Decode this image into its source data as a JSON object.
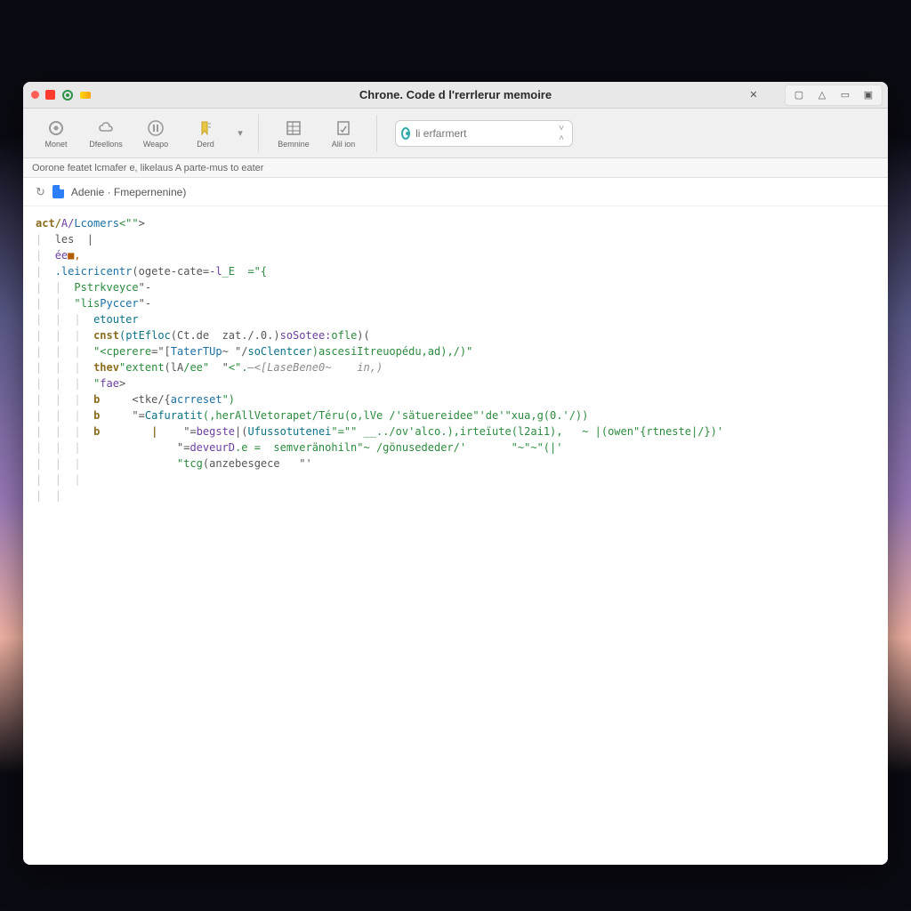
{
  "window": {
    "title": "Chrone. Code d l'rerrlerur memoire"
  },
  "titlebar_icons": {
    "close": "close",
    "stop": "stop",
    "record": "record",
    "status": "status"
  },
  "win_right": [
    "✕",
    "▢",
    "△",
    "▭",
    "▣"
  ],
  "toolbar": {
    "group1": [
      {
        "label": "Monet",
        "icon": "target"
      },
      {
        "label": "Dfeellons",
        "icon": "cloud"
      },
      {
        "label": "Weapo",
        "icon": "pause"
      },
      {
        "label": "Derd",
        "icon": "bookmark"
      }
    ],
    "dropdown": "▾",
    "group2": [
      {
        "label": "Bemnine",
        "icon": "grid"
      },
      {
        "label": "Alil ion",
        "icon": "doc"
      }
    ]
  },
  "search": {
    "placeholder": "li erfarmert"
  },
  "status_strip": "Oorone featet lcmafer e, likelaus A parte-mus to eater",
  "breadcrumb": {
    "reload": "↻",
    "file_label": "Adenie · Fmepernenine)"
  },
  "code_lines": [
    {
      "indent": 0,
      "tokens": [
        {
          "t": "act/",
          "c": "kw"
        },
        {
          "t": "A/",
          "c": "attr"
        },
        {
          "t": "Lcomers",
          "c": "class"
        },
        {
          "t": "<\"\"",
          "c": "str"
        },
        {
          "t": ">",
          "c": "punc"
        }
      ]
    },
    {
      "indent": 1,
      "tokens": [
        {
          "t": "les  |",
          "c": "punc"
        }
      ]
    },
    {
      "indent": 1,
      "tokens": [
        {
          "t": "ée",
          "c": "attr"
        },
        {
          "t": "■,",
          "c": "num"
        }
      ]
    },
    {
      "indent": 1,
      "tokens": [
        {
          "t": ".leicricentr",
          "c": "class"
        },
        {
          "t": "(ogete-cate=",
          "c": "punc"
        },
        {
          "t": "-l",
          "c": "attr"
        },
        {
          "t": "_E  =\"{",
          "c": "str"
        }
      ]
    },
    {
      "indent": 2,
      "tokens": [
        {
          "t": "Pstrkveyce",
          "c": "str"
        },
        {
          "t": "\"-",
          "c": "punc"
        }
      ]
    },
    {
      "indent": 2,
      "tokens": [
        {
          "t": "\"lis",
          "c": "str"
        },
        {
          "t": "Pyccer",
          "c": "class"
        },
        {
          "t": "\"-",
          "c": "punc"
        }
      ]
    },
    {
      "indent": 3,
      "tokens": [
        {
          "t": "etouter",
          "c": "func"
        }
      ]
    },
    {
      "indent": 3,
      "tokens": [
        {
          "t": "cnst",
          "c": "kw"
        },
        {
          "t": "(ptEfloc",
          "c": "func"
        },
        {
          "t": "(Ct.de  zat./.0.)",
          "c": "punc"
        },
        {
          "t": "soSotee:",
          "c": "attr"
        },
        {
          "t": "ofle",
          "c": "str"
        },
        {
          "t": ")(",
          "c": "punc"
        }
      ]
    },
    {
      "indent": 3,
      "tokens": [
        {
          "t": "\"<cperere",
          "c": "str"
        },
        {
          "t": "=\"[",
          "c": "punc"
        },
        {
          "t": "TaterTUp",
          "c": "class"
        },
        {
          "t": "~ \"/",
          "c": "punc"
        },
        {
          "t": "soClentcer",
          "c": "func"
        },
        {
          "t": ")ascesiItreuopédu,ad),/)\"",
          "c": "str"
        }
      ]
    },
    {
      "indent": 3,
      "tokens": [
        {
          "t": "thev",
          "c": "kw"
        },
        {
          "t": "\"extent",
          "c": "str"
        },
        {
          "t": "(lA",
          "c": "punc"
        },
        {
          "t": "/ee\"",
          "c": "str"
        },
        {
          "t": "  \"",
          "c": "punc"
        },
        {
          "t": "<\".",
          "c": "str"
        },
        {
          "t": "—<[LaseBene0~    in,)",
          "c": "comment"
        }
      ]
    },
    {
      "indent": 3,
      "tokens": [
        {
          "t": "\"",
          "c": "str"
        },
        {
          "t": "fae",
          "c": "attr"
        },
        {
          "t": ">",
          "c": "punc"
        }
      ]
    },
    {
      "indent": 3,
      "tokens": [
        {
          "t": "b     ",
          "c": "kw"
        },
        {
          "t": "<tke",
          "c": "punc"
        },
        {
          "t": "/{",
          "c": "punc"
        },
        {
          "t": "acrreset",
          "c": "class"
        },
        {
          "t": "\")",
          "c": "str"
        }
      ]
    },
    {
      "indent": 3,
      "tokens": [
        {
          "t": "b     ",
          "c": "kw"
        },
        {
          "t": "\"=",
          "c": "punc"
        },
        {
          "t": "Cafuratit",
          "c": "func"
        },
        {
          "t": "(,herAllVetorapet/Téru(o,lVe /'sätuereidee\"'de'\"xua,g(0.'/))",
          "c": "str"
        }
      ]
    },
    {
      "indent": 3,
      "tokens": [
        {
          "t": "b        |    ",
          "c": "kw"
        },
        {
          "t": "\"=",
          "c": "punc"
        },
        {
          "t": "begste",
          "c": "attr"
        },
        {
          "t": "|(",
          "c": "punc"
        },
        {
          "t": "Ufussotutenei",
          "c": "func"
        },
        {
          "t": "\"=\"\" __../ov'alco.),irteïute(l2ai1),   ~ |(owen\"{rtneste|/})'",
          "c": "str"
        }
      ]
    },
    {
      "indent": 3,
      "tokens": [
        {
          "t": "             ",
          "c": ""
        },
        {
          "t": "\"=",
          "c": "punc"
        },
        {
          "t": "deveurD",
          "c": "attr"
        },
        {
          "t": ".e =  semveränohiln\"~ /gönusededer/'       \"~\"~\"(|'",
          "c": "str"
        }
      ]
    },
    {
      "indent": 3,
      "tokens": [
        {
          "t": "             ",
          "c": ""
        },
        {
          "t": "\"tcg",
          "c": "str"
        },
        {
          "t": "(anzebesgece   \"'",
          "c": "punc"
        }
      ]
    },
    {
      "indent": 2,
      "tokens": [
        {
          "t": "|",
          "c": "guide"
        }
      ]
    },
    {
      "indent": 1,
      "tokens": [
        {
          "t": "|",
          "c": "guide"
        }
      ]
    }
  ]
}
